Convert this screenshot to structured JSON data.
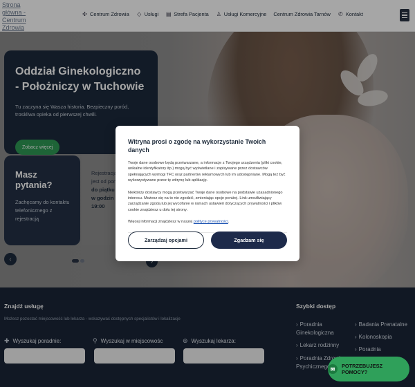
{
  "header": {
    "logo_alt": "Strona główna - Centrum Zdrowia",
    "nav": [
      {
        "label": "Centrum Zdrowia",
        "icon": "sparkle-icon"
      },
      {
        "label": "Usługi",
        "icon": "diamond-icon"
      },
      {
        "label": "Strefa Pacjenta",
        "icon": "document-icon"
      },
      {
        "label": "Usługi Komercyjne",
        "icon": "person-icon"
      },
      {
        "label": "Centrum Zdrowia Tarnów",
        "icon": ""
      },
      {
        "label": "Kontakt",
        "icon": "phone-icon"
      }
    ]
  },
  "hero": {
    "title": "Oddział Ginekologiczno - Położniczy w Tuchowie",
    "subtitle": "Tu zaczyna się Wasza historia. Bezpieczny poród, troskliwa opieka od pierwszej chwili.",
    "cta": "Zobacz więcej",
    "questions_title": "Masz pytania?",
    "questions_text": "Zachęcamy do kontaktu telefonicznego z rejestracją",
    "hours_line1": "Rejestracja",
    "hours_line2": "jest od pon",
    "hours_line3": "do piątku",
    "hours_line4": "w godzin",
    "hours_line5": "19:00"
  },
  "modal": {
    "title": "Witryna prosi o zgodę na wykorzystanie Twoich danych",
    "para1": "Twoje dane osobowe będą przetwarzane, a informacje z Twojego urządzenia (pliki cookie, unikalne identyfikatory itp.) mogą być wyświetlane i zapisywane przez dostawców spełniających wymogi TFC oraz partnerów reklamowych lub im udostępniane. Mogą też być wykorzystywane przez tę witrynę lub aplikację.",
    "para2": "Niektórzy dostawcy mogą przetwarzać Twoje dane osobowe na podstawie uzasadnionego interesu. Możesz się na to nie zgodzić, zmieniając opcje poniżej. Link umożliwiający zarządzanie zgodą lub jej wycofanie w ramach ustawień dotyczących prywatności i plików cookie znajdziesz u dołu tej strony.",
    "para3_prefix": "Więcej informacji znajdziesz w naszej ",
    "para3_link": "polityce prywatności",
    "manage_label": "Zarządzaj opcjami",
    "accept_label": "Zgadzam się"
  },
  "search": {
    "title": "Znajdź usługę",
    "subtitle": "Możesz pozostać miejscowość lub lekarza - wskazywać dostępnych specjalistów i lokalizacje",
    "fields": [
      {
        "label": "Wyszukaj poradnie:",
        "icon": "plus-icon"
      },
      {
        "label": "Wyszukaj w miejscowośc",
        "icon": "pin-icon"
      },
      {
        "label": "Wyszukaj lekarza:",
        "icon": "search-icon"
      }
    ]
  },
  "quick": {
    "title": "Szybki dostęp",
    "col1": [
      "Poradnia Ginekologiczna",
      "Lekarz rodzinny",
      "Poradnia Zdrowia Psychicznego"
    ],
    "col2": [
      "Badania Prenatalne",
      "Kolonoskopia",
      "Poradnia"
    ]
  },
  "help": {
    "label": "POTRZEBUJESZ POMOCY?"
  }
}
